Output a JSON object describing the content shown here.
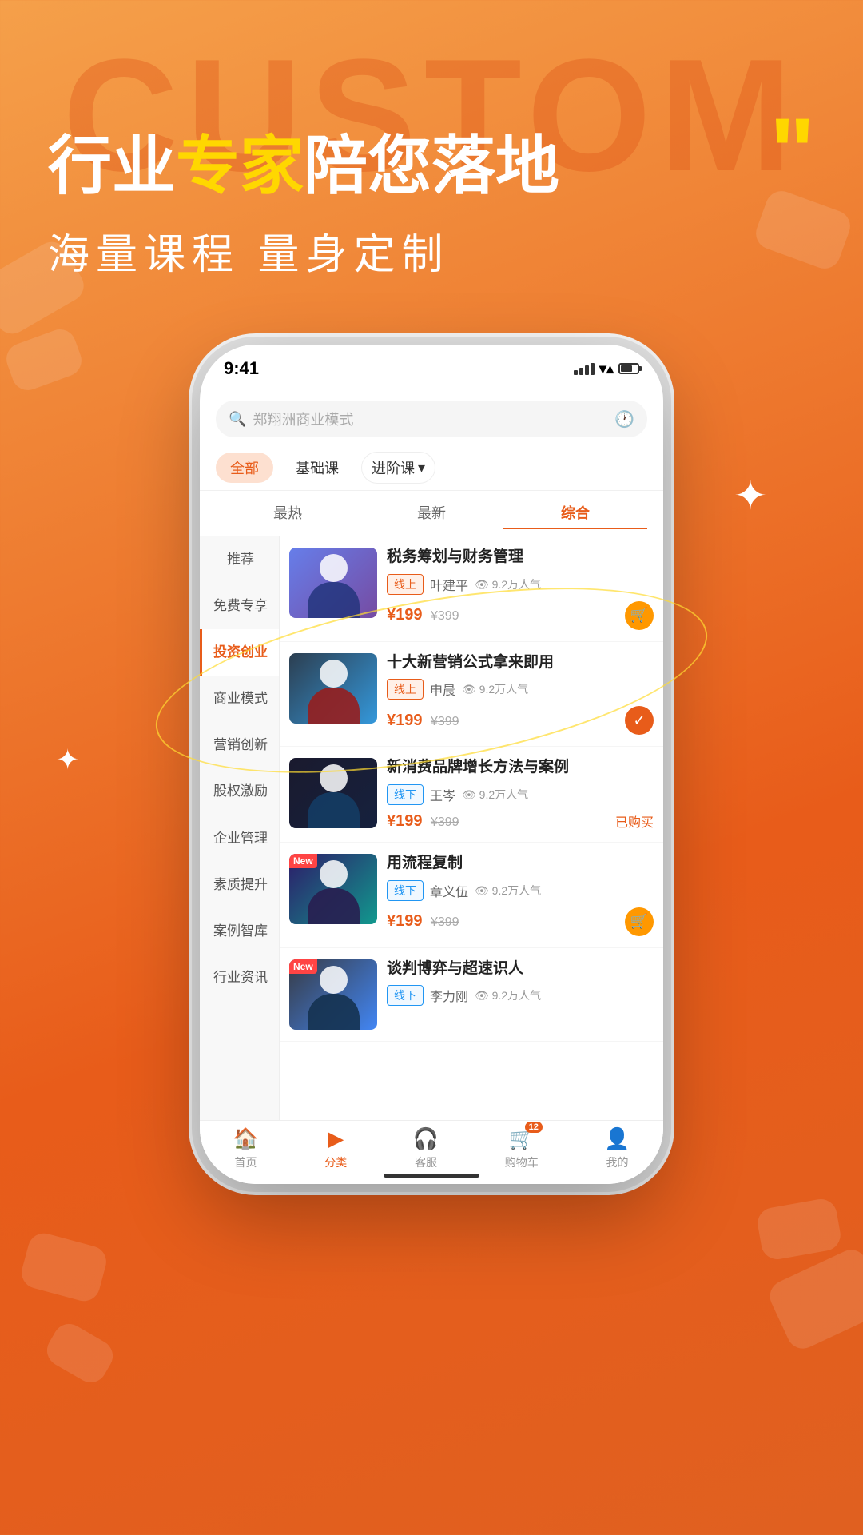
{
  "background": {
    "bg_text": "CUSTOM",
    "gradient_start": "#f5a04a",
    "gradient_end": "#e06020"
  },
  "hero": {
    "title_part1": "行业",
    "title_highlight": "专家",
    "title_part2": "陪您落地",
    "subtitle": "海量课程   量身定制",
    "quote_mark": "”"
  },
  "phone": {
    "status_bar": {
      "time": "9:41"
    },
    "search": {
      "placeholder": "郑翔洲商业模式"
    },
    "filter_tabs": [
      {
        "label": "全部",
        "active": true
      },
      {
        "label": "基础课",
        "active": false
      },
      {
        "label": "进阶课",
        "active": false,
        "has_dropdown": true
      }
    ],
    "sort_tabs": [
      {
        "label": "最热",
        "active": false
      },
      {
        "label": "最新",
        "active": false
      },
      {
        "label": "综合",
        "active": true
      }
    ],
    "sidebar_items": [
      {
        "label": "推荐",
        "active": false
      },
      {
        "label": "免费专享",
        "active": false
      },
      {
        "label": "投资创业",
        "active": true
      },
      {
        "label": "商业模式",
        "active": false
      },
      {
        "label": "营销创新",
        "active": false
      },
      {
        "label": "股权激励",
        "active": false
      },
      {
        "label": "企业管理",
        "active": false
      },
      {
        "label": "素质提升",
        "active": false
      },
      {
        "label": "案例智库",
        "active": false
      },
      {
        "label": "行业资讯",
        "active": false
      }
    ],
    "courses": [
      {
        "id": 1,
        "title": "税务筹划与财务管理",
        "tag": "线上",
        "tag_type": "online",
        "teacher": "叶建平",
        "views": "9.2万人气",
        "price_current": "¥199",
        "price_original": "¥399",
        "is_new": false,
        "purchased": false,
        "cart_checked": false,
        "thumb_color": "1"
      },
      {
        "id": 2,
        "title": "十大新营销公式拿来即用",
        "tag": "线上",
        "tag_type": "online",
        "teacher": "申晨",
        "views": "9.2万人气",
        "price_current": "¥199",
        "price_original": "¥399",
        "is_new": false,
        "purchased": false,
        "cart_checked": true,
        "thumb_color": "2"
      },
      {
        "id": 3,
        "title": "新消费品牌增长方法与案例",
        "tag": "线下",
        "tag_type": "offline",
        "teacher": "王岑",
        "views": "9.2万人气",
        "price_current": "¥199",
        "price_original": "¥399",
        "is_new": false,
        "purchased": true,
        "purchased_label": "已购买",
        "cart_checked": false,
        "thumb_color": "3"
      },
      {
        "id": 4,
        "title": "用流程复制",
        "tag": "线下",
        "tag_type": "offline",
        "teacher": "章义伍",
        "views": "9.2万人气",
        "price_current": "¥199",
        "price_original": "¥399",
        "is_new": true,
        "new_label": "New",
        "purchased": false,
        "cart_checked": false,
        "thumb_color": "4"
      },
      {
        "id": 5,
        "title": "谈判博弈与超速识人",
        "tag": "线下",
        "tag_type": "offline",
        "teacher": "李力刚",
        "views": "9.2万人气",
        "price_current": "¥199",
        "price_original": "¥399",
        "is_new": true,
        "new_label": "New",
        "purchased": false,
        "cart_checked": false,
        "thumb_color": "5"
      }
    ],
    "bottom_nav": [
      {
        "icon": "🏠",
        "label": "首页",
        "active": false
      },
      {
        "icon": "▶",
        "label": "分类",
        "active": true
      },
      {
        "icon": "🎧",
        "label": "客服",
        "active": false
      },
      {
        "icon": "🛒",
        "label": "购物车",
        "active": false,
        "badge": "12"
      },
      {
        "icon": "👤",
        "label": "我的",
        "active": false
      }
    ]
  }
}
